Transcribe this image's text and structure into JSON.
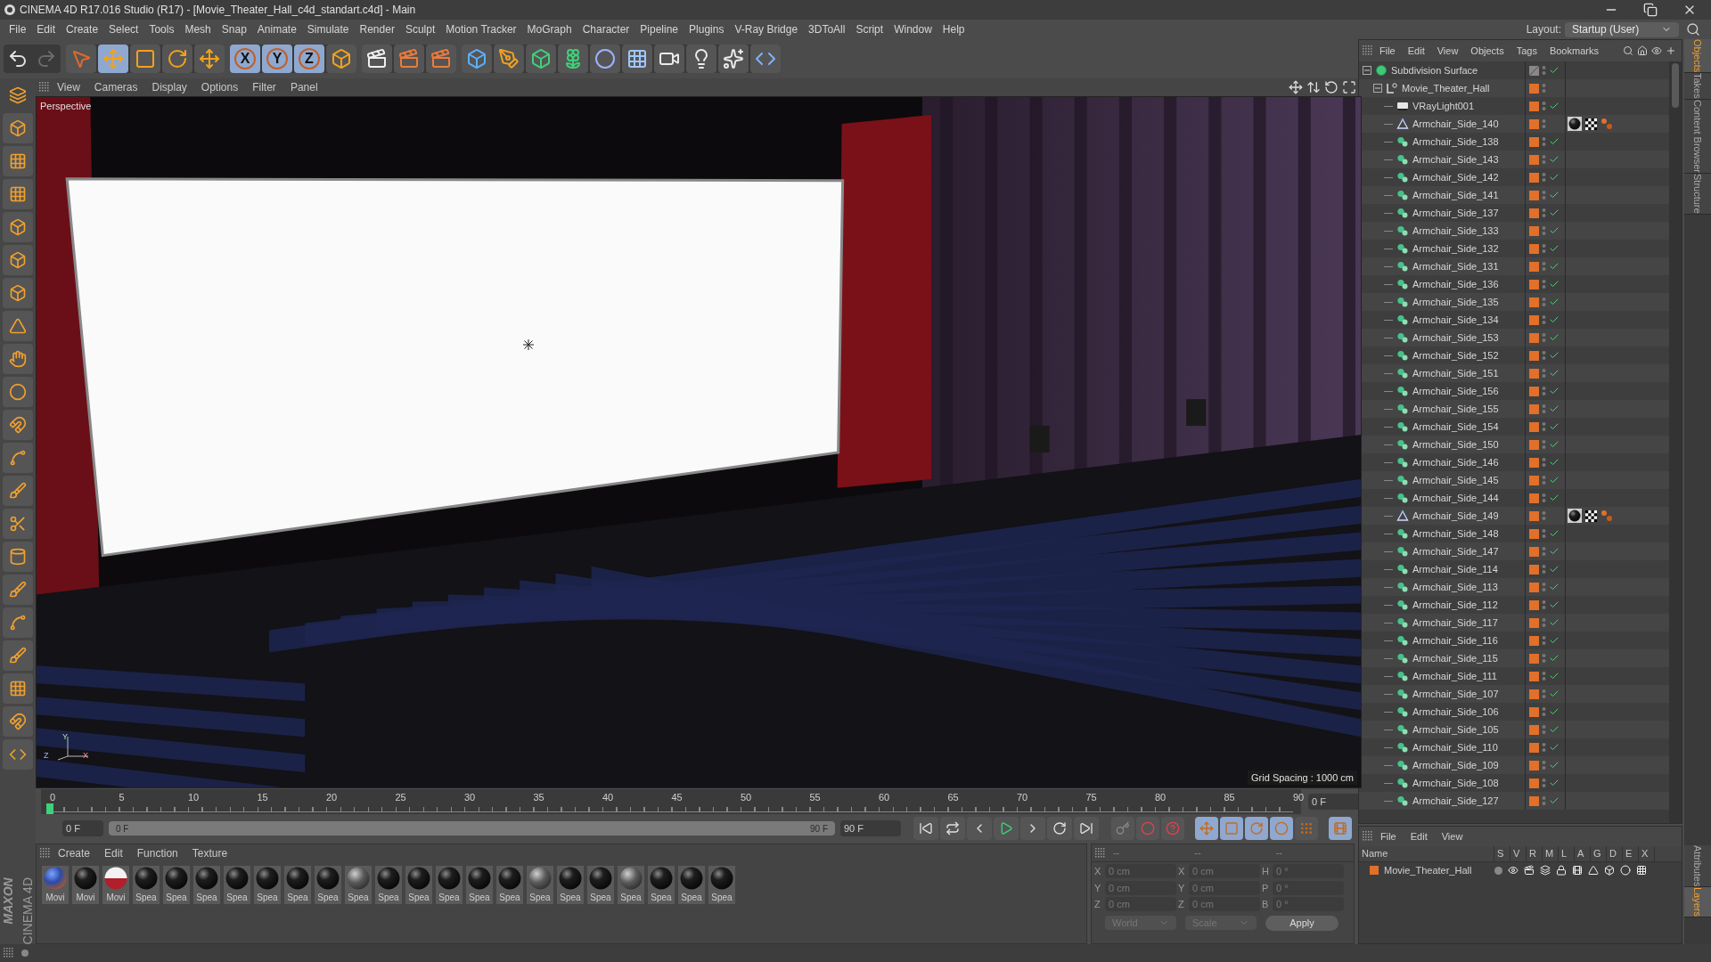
{
  "window": {
    "title": "CINEMA 4D R17.016 Studio (R17) - [Movie_Theater_Hall_c4d_standart.c4d] - Main"
  },
  "menu": [
    "File",
    "Edit",
    "Create",
    "Select",
    "Tools",
    "Mesh",
    "Snap",
    "Animate",
    "Simulate",
    "Render",
    "Sculpt",
    "Motion Tracker",
    "MoGraph",
    "Character",
    "Pipeline",
    "Plugins",
    "V-Ray Bridge",
    "3DToAll",
    "Script",
    "Window",
    "Help"
  ],
  "layout": {
    "label": "Layout:",
    "value": "Startup (User)"
  },
  "toolbar": {
    "tools": [
      {
        "kind": "select",
        "selected": false
      },
      {
        "kind": "move",
        "selected": true
      },
      {
        "kind": "scale",
        "selected": false
      },
      {
        "kind": "rotate",
        "selected": false
      },
      {
        "kind": "transform",
        "selected": false
      }
    ],
    "axes": [
      {
        "label": "X",
        "selected": true
      },
      {
        "label": "Y",
        "selected": true
      },
      {
        "label": "Z",
        "selected": true
      }
    ]
  },
  "viewport": {
    "menu": [
      "View",
      "Cameras",
      "Display",
      "Options",
      "Filter",
      "Panel"
    ],
    "camera": "Perspective",
    "grid_spacing": "Grid Spacing : 1000 cm",
    "axis_labels": [
      "Y",
      "Z",
      "X"
    ]
  },
  "timeline": {
    "ticks": [
      "0",
      "5",
      "10",
      "15",
      "20",
      "25",
      "30",
      "35",
      "40",
      "45",
      "50",
      "55",
      "60",
      "65",
      "70",
      "75",
      "80",
      "85",
      "90"
    ],
    "level": 0,
    "current": "0 F",
    "start": "0 F",
    "range_start": "0 F",
    "range_end": "90 F",
    "range": {
      "level": 1
    },
    "end": "90 F",
    "keys": [
      {
        "kind": "move",
        "selected": true
      },
      {
        "kind": "scale",
        "selected": true
      },
      {
        "kind": "rotate",
        "selected": true
      },
      {
        "kind": "param",
        "selected": true
      },
      {
        "kind": "points",
        "selected": false
      },
      {
        "kind": "film",
        "selected": true
      }
    ]
  },
  "materials": {
    "menu": [
      "Create",
      "Edit",
      "Function",
      "Texture"
    ],
    "items": [
      {
        "label": "Movi",
        "kind": "blue"
      },
      {
        "label": "Movi",
        "kind": "dark"
      },
      {
        "label": "Movi",
        "kind": "redwhite"
      },
      {
        "label": "Spea",
        "kind": "dark"
      },
      {
        "label": "Spea",
        "kind": "dark"
      },
      {
        "label": "Spea",
        "kind": "dark"
      },
      {
        "label": "Spea",
        "kind": "dark"
      },
      {
        "label": "Spea",
        "kind": "dark"
      },
      {
        "label": "Spea",
        "kind": "dark"
      },
      {
        "label": "Spea",
        "kind": "dark"
      },
      {
        "label": "Spea",
        "kind": "grey"
      },
      {
        "label": "Spea",
        "kind": "dark"
      },
      {
        "label": "Spea",
        "kind": "dark"
      },
      {
        "label": "Spea",
        "kind": "dark"
      },
      {
        "label": "Spea",
        "kind": "dark"
      },
      {
        "label": "Spea",
        "kind": "dark"
      },
      {
        "label": "Spea",
        "kind": "grey"
      },
      {
        "label": "Spea",
        "kind": "dark"
      },
      {
        "label": "Spea",
        "kind": "dark"
      },
      {
        "label": "Spea",
        "kind": "grey"
      },
      {
        "label": "Spea",
        "kind": "dark"
      },
      {
        "label": "Spea",
        "kind": "dark"
      },
      {
        "label": "Spea",
        "kind": "dark"
      }
    ]
  },
  "coordinates": {
    "headers": [
      "--",
      "--",
      "--"
    ],
    "rows": [
      {
        "axis": "X",
        "position": "0 cm",
        "size_axis": "X",
        "size": "0 cm",
        "rot_axis": "H",
        "rotation": "0 °"
      },
      {
        "axis": "Y",
        "position": "0 cm",
        "size_axis": "Y",
        "size": "0 cm",
        "rot_axis": "P",
        "rotation": "0 °"
      },
      {
        "axis": "Z",
        "position": "0 cm",
        "size_axis": "Z",
        "size": "0 cm",
        "rot_axis": "B",
        "rotation": "0 °"
      }
    ],
    "space": "World",
    "mode": "Scale",
    "apply": "Apply"
  },
  "objects": {
    "menu": [
      "File",
      "Edit",
      "View",
      "Objects",
      "Tags",
      "Bookmarks"
    ],
    "tree": [
      {
        "name": "Subdivision Surface",
        "kind": "subdivision",
        "layer": false,
        "checked": true,
        "tags": false,
        "expanded": true,
        "children": [
          {
            "name": "Movie_Theater_Hall",
            "kind": "null",
            "layer": true,
            "checked": false,
            "tags": false,
            "expanded": true,
            "children": [
              {
                "name": "VRayLight001",
                "kind": "light",
                "layer": true,
                "checked": true,
                "tags": false
              },
              {
                "name": "Armchair_Side_140",
                "kind": "polygon",
                "layer": true,
                "checked": false,
                "tags": true
              },
              {
                "name": "Armchair_Side_138",
                "kind": "mesh",
                "layer": true,
                "checked": true,
                "tags": false
              },
              {
                "name": "Armchair_Side_143",
                "kind": "mesh",
                "layer": true,
                "checked": true,
                "tags": false
              },
              {
                "name": "Armchair_Side_142",
                "kind": "mesh",
                "layer": true,
                "checked": true,
                "tags": false
              },
              {
                "name": "Armchair_Side_141",
                "kind": "mesh",
                "layer": true,
                "checked": true,
                "tags": false
              },
              {
                "name": "Armchair_Side_137",
                "kind": "mesh",
                "layer": true,
                "checked": true,
                "tags": false
              },
              {
                "name": "Armchair_Side_133",
                "kind": "mesh",
                "layer": true,
                "checked": true,
                "tags": false
              },
              {
                "name": "Armchair_Side_132",
                "kind": "mesh",
                "layer": true,
                "checked": true,
                "tags": false
              },
              {
                "name": "Armchair_Side_131",
                "kind": "mesh",
                "layer": true,
                "checked": true,
                "tags": false
              },
              {
                "name": "Armchair_Side_136",
                "kind": "mesh",
                "layer": true,
                "checked": true,
                "tags": false
              },
              {
                "name": "Armchair_Side_135",
                "kind": "mesh",
                "layer": true,
                "checked": true,
                "tags": false
              },
              {
                "name": "Armchair_Side_134",
                "kind": "mesh",
                "layer": true,
                "checked": true,
                "tags": false
              },
              {
                "name": "Armchair_Side_153",
                "kind": "mesh",
                "layer": true,
                "checked": true,
                "tags": false
              },
              {
                "name": "Armchair_Side_152",
                "kind": "mesh",
                "layer": true,
                "checked": true,
                "tags": false
              },
              {
                "name": "Armchair_Side_151",
                "kind": "mesh",
                "layer": true,
                "checked": true,
                "tags": false
              },
              {
                "name": "Armchair_Side_156",
                "kind": "mesh",
                "layer": true,
                "checked": true,
                "tags": false
              },
              {
                "name": "Armchair_Side_155",
                "kind": "mesh",
                "layer": true,
                "checked": true,
                "tags": false
              },
              {
                "name": "Armchair_Side_154",
                "kind": "mesh",
                "layer": true,
                "checked": true,
                "tags": false
              },
              {
                "name": "Armchair_Side_150",
                "kind": "mesh",
                "layer": true,
                "checked": true,
                "tags": false
              },
              {
                "name": "Armchair_Side_146",
                "kind": "mesh",
                "layer": true,
                "checked": true,
                "tags": false
              },
              {
                "name": "Armchair_Side_145",
                "kind": "mesh",
                "layer": true,
                "checked": true,
                "tags": false
              },
              {
                "name": "Armchair_Side_144",
                "kind": "mesh",
                "layer": true,
                "checked": true,
                "tags": false
              },
              {
                "name": "Armchair_Side_149",
                "kind": "polygon",
                "layer": true,
                "checked": false,
                "tags": true
              },
              {
                "name": "Armchair_Side_148",
                "kind": "mesh",
                "layer": true,
                "checked": true,
                "tags": false
              },
              {
                "name": "Armchair_Side_147",
                "kind": "mesh",
                "layer": true,
                "checked": true,
                "tags": false
              },
              {
                "name": "Armchair_Side_114",
                "kind": "mesh",
                "layer": true,
                "checked": true,
                "tags": false
              },
              {
                "name": "Armchair_Side_113",
                "kind": "mesh",
                "layer": true,
                "checked": true,
                "tags": false
              },
              {
                "name": "Armchair_Side_112",
                "kind": "mesh",
                "layer": true,
                "checked": true,
                "tags": false
              },
              {
                "name": "Armchair_Side_117",
                "kind": "mesh",
                "layer": true,
                "checked": true,
                "tags": false
              },
              {
                "name": "Armchair_Side_116",
                "kind": "mesh",
                "layer": true,
                "checked": true,
                "tags": false
              },
              {
                "name": "Armchair_Side_115",
                "kind": "mesh",
                "layer": true,
                "checked": true,
                "tags": false
              },
              {
                "name": "Armchair_Side_111",
                "kind": "mesh",
                "layer": true,
                "checked": true,
                "tags": false
              },
              {
                "name": "Armchair_Side_107",
                "kind": "mesh",
                "layer": true,
                "checked": true,
                "tags": false
              },
              {
                "name": "Armchair_Side_106",
                "kind": "mesh",
                "layer": true,
                "checked": true,
                "tags": false
              },
              {
                "name": "Armchair_Side_105",
                "kind": "mesh",
                "layer": true,
                "checked": true,
                "tags": false
              },
              {
                "name": "Armchair_Side_110",
                "kind": "mesh",
                "layer": true,
                "checked": true,
                "tags": false
              },
              {
                "name": "Armchair_Side_109",
                "kind": "mesh",
                "layer": true,
                "checked": true,
                "tags": false
              },
              {
                "name": "Armchair_Side_108",
                "kind": "mesh",
                "layer": true,
                "checked": true,
                "tags": false
              },
              {
                "name": "Armchair_Side_127",
                "kind": "mesh",
                "layer": true,
                "checked": true,
                "tags": false
              }
            ]
          }
        ]
      }
    ]
  },
  "tabs_top": [
    {
      "label": "Objects",
      "selected": true
    },
    {
      "label": "Takes",
      "selected": false
    },
    {
      "label": "Content Browser",
      "selected": false
    },
    {
      "label": "Structure",
      "selected": false
    }
  ],
  "layers": {
    "menu": [
      "File",
      "Edit",
      "View"
    ],
    "columns": [
      "Name",
      "S",
      "V",
      "R",
      "M",
      "L",
      "A",
      "G",
      "D",
      "E",
      "X"
    ],
    "rows": [
      {
        "name": "Movie_Theater_Hall",
        "color": "#e0702a"
      }
    ]
  },
  "tabs_bottom": [
    {
      "label": "Attributes",
      "selected": false
    },
    {
      "label": "Layers",
      "selected": true
    }
  ],
  "logo": {
    "maker": "MAXON",
    "product": "CINEMA 4D"
  }
}
